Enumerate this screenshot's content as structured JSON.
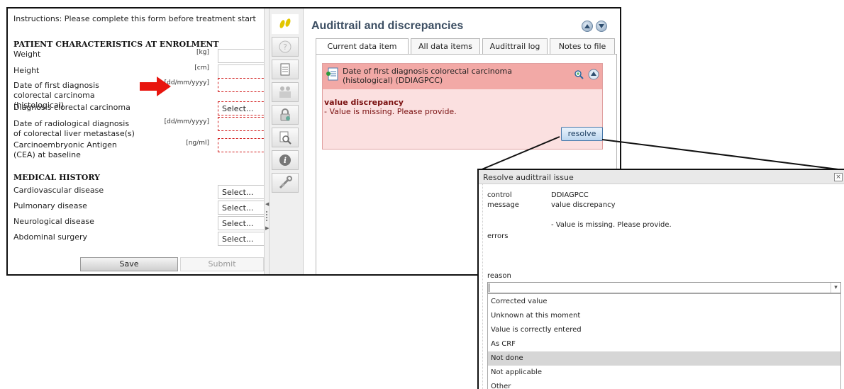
{
  "form": {
    "instructions": "Instructions: Please complete this form before treatment start",
    "section1_title": "PATIENT CHARACTERISTICS AT ENROLMENT",
    "weight_label": "Weight",
    "weight_unit": "[kg]",
    "height_label": "Height",
    "height_unit": "[cm]",
    "diag_date_label": "Date of first diagnosis colorectal carcinoma (histological)",
    "diag_date_unit": "[dd/mm/yyyy]",
    "diag_crc_label": "Diagnosis clorectal carcinoma",
    "diag_crc_value": "Select...",
    "radio_date_label": "Date of radiological diagnosis of colorectal liver metastase(s)",
    "radio_date_unit": "[dd/mm/yyyy]",
    "cea_label": "Carcinoembryonic Antigen (CEA) at baseline",
    "cea_unit": "[ng/ml]",
    "section2_title": "MEDICAL HISTORY",
    "cardio_label": "Cardiovascular disease",
    "cardio_value": "Select...",
    "pulm_label": "Pulmonary disease",
    "pulm_value": "Select...",
    "neuro_label": "Neurological disease",
    "neuro_value": "Select...",
    "abd_label": "Abdominal surgery",
    "abd_value": "Select...",
    "save_label": "Save",
    "submit_label": "Submit"
  },
  "audit": {
    "title": "Audittrail and discrepancies",
    "tabs": [
      "Current data item",
      "All data items",
      "Audittrail log",
      "Notes to file"
    ],
    "item_title": "Date of first diagnosis colorectal carcinoma (histological) (DDIAGPCC)",
    "issue_type": "value discrepancy",
    "issue_message": "- Value is missing. Please provide.",
    "resolve_label": "resolve"
  },
  "dialog": {
    "title": "Resolve audittrail issue",
    "close_label": "×",
    "control_key": "control",
    "control_value": "DDIAGPCC",
    "message_key": "message",
    "message_value": "value discrepancy",
    "message_detail": "- Value is missing. Please provide.",
    "errors_key": "errors",
    "reason_label": "reason",
    "reason_options": [
      "Corrected value",
      "Unknown at this moment",
      "Value is correctly entered",
      "As CRF",
      "Not done",
      "Not applicable",
      "Other"
    ],
    "highlighted_option": "Not done"
  },
  "colors": {
    "error_border": "#d12020",
    "arrow": "#e8150e",
    "issue_header": "#f2a9a6",
    "issue_body": "#fbe0e0",
    "issue_text": "#7a1010",
    "title_text": "#3d4f63"
  },
  "icons": {
    "toolbar": [
      "footsteps-icon",
      "help-icon",
      "document-icon",
      "people-icon",
      "lock-icon",
      "magnifier-icon",
      "info-icon",
      "tools-icon"
    ]
  }
}
